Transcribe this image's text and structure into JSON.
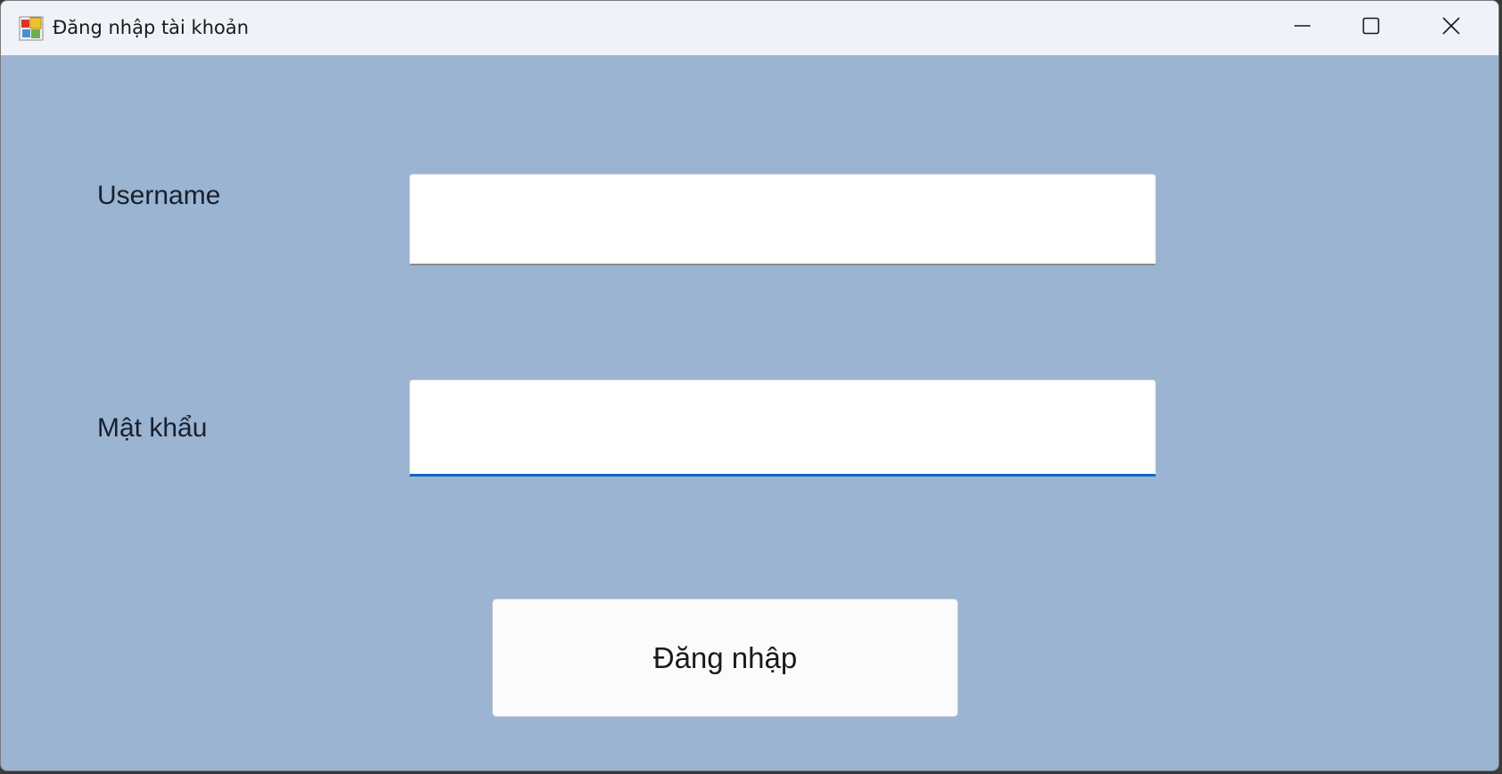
{
  "window": {
    "title": "Đăng nhập tài khoản",
    "app_icon": "winforms-app-icon",
    "controls": {
      "minimize_icon": "minimize-icon",
      "maximize_icon": "maximize-icon",
      "close_icon": "close-icon"
    }
  },
  "form": {
    "username_label": "Username",
    "username_value": "",
    "password_label": "Mật khẩu",
    "password_value": "",
    "login_button_label": "Đăng nhập"
  },
  "colors": {
    "form_background": "#9ab4d1",
    "titlebar_background": "#eff2f8",
    "focus_accent": "#1466c8"
  }
}
